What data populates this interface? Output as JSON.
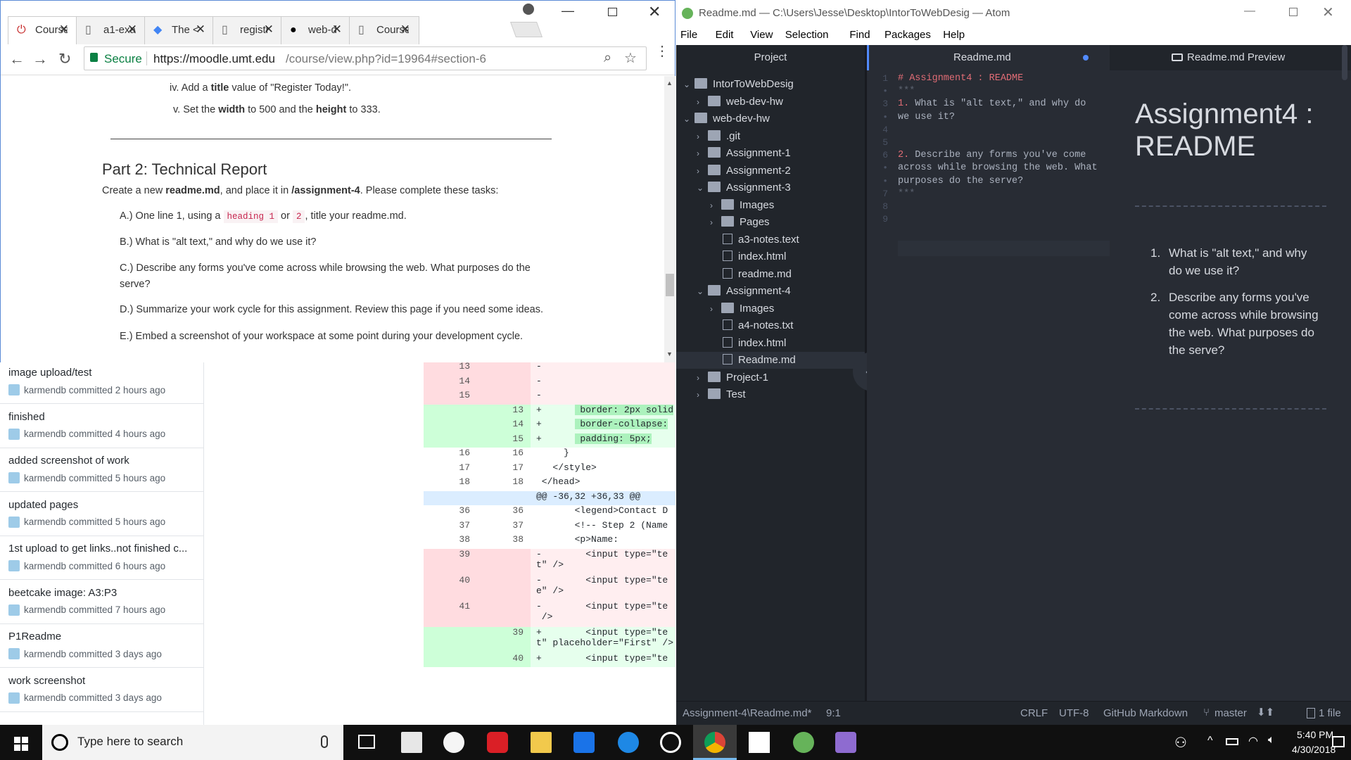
{
  "chrome": {
    "tabs": [
      {
        "title": "Course",
        "icon": "power-icon"
      },
      {
        "title": "a1-exa",
        "icon": "page-icon"
      },
      {
        "title": "The <",
        "icon": "drive-icon"
      },
      {
        "title": "registr",
        "icon": "page-icon"
      },
      {
        "title": "web-d",
        "icon": "github-icon"
      },
      {
        "title": "Course",
        "icon": "page-icon"
      }
    ],
    "secure_label": "Secure",
    "url_host": "https://moodle.umt.edu",
    "url_path": "/course/view.php?id=19964#section-6"
  },
  "moodle": {
    "line_iv_a": "iv. Add a ",
    "line_iv_b": "title",
    "line_iv_c": " value of \"Register Today!\".",
    "line_v_a": "v. Set the ",
    "line_v_b": "width",
    "line_v_c": " to 500 and the ",
    "line_v_d": "height",
    "line_v_e": " to 333.",
    "part2_title": "Part 2: Technical Report",
    "intro_a": "Create a new ",
    "intro_b": "readme.md",
    "intro_c": ", and place it in ",
    "intro_d": "/assignment-4",
    "intro_e": ". Please complete these tasks:",
    "task_a1": "A.) One line 1, using a ",
    "task_a_code1": "heading 1",
    "task_a_or": " or ",
    "task_a_code2": "2",
    "task_a2": ", title your readme.md.",
    "task_b": "B.) What is \"alt text,\" and why do we use it?",
    "task_c1": "C.) Describe any forms you've come across while browsing the web. What purposes do the",
    "task_c2": "serve?",
    "task_d1": "D.) Summarize your work cycle for this assignment. Review ",
    "task_d_link": "this page",
    "task_d2": " if you need some ideas.",
    "task_e": "E.) Embed a screenshot of your workspace at some point during your development cycle."
  },
  "commits": [
    {
      "message": "image upload/test",
      "meta": "karmendb committed 2 hours ago"
    },
    {
      "message": "finished",
      "meta": "karmendb committed 4 hours ago"
    },
    {
      "message": "added screenshot of work",
      "meta": "karmendb committed 5 hours ago"
    },
    {
      "message": "updated pages",
      "meta": "karmendb committed 5 hours ago"
    },
    {
      "message": "1st upload to get links..not finished c...",
      "meta": "karmendb committed 6 hours ago"
    },
    {
      "message": "beetcake image: A3:P3",
      "meta": "karmendb committed 7 hours ago"
    },
    {
      "message": "P1Readme",
      "meta": "karmendb committed 3 days ago"
    },
    {
      "message": "work screenshot",
      "meta": "karmendb committed 3 days ago"
    }
  ],
  "diff": [
    {
      "t": "del",
      "o": "13",
      "n": "",
      "c": "-"
    },
    {
      "t": "del",
      "o": "14",
      "n": "",
      "c": "-"
    },
    {
      "t": "del",
      "o": "15",
      "n": "",
      "c": "-"
    },
    {
      "t": "add",
      "o": "",
      "n": "13",
      "c": "+       border: 2px solid"
    },
    {
      "t": "add",
      "o": "",
      "n": "14",
      "c": "+       border-collapse:"
    },
    {
      "t": "add",
      "o": "",
      "n": "15",
      "c": "+       padding: 5px;"
    },
    {
      "t": "ctx",
      "o": "16",
      "n": "16",
      "c": "     }"
    },
    {
      "t": "ctx",
      "o": "17",
      "n": "17",
      "c": "   </style>"
    },
    {
      "t": "ctx",
      "o": "18",
      "n": "18",
      "c": " </head>"
    },
    {
      "t": "hunk",
      "o": "",
      "n": "",
      "c": "@@ -36,32 +36,33 @@"
    },
    {
      "t": "ctx",
      "o": "36",
      "n": "36",
      "c": "       <legend>Contact D"
    },
    {
      "t": "ctx",
      "o": "37",
      "n": "37",
      "c": "       <!-- Step 2 (Name"
    },
    {
      "t": "ctx",
      "o": "38",
      "n": "38",
      "c": "       <p>Name:"
    },
    {
      "t": "del2",
      "o": "39",
      "n": "",
      "c": "-        <input type=\"te",
      "c2": "t\" />"
    },
    {
      "t": "del2",
      "o": "40",
      "n": "",
      "c": "-        <input type=\"te",
      "c2": "e\" />"
    },
    {
      "t": "del2",
      "o": "41",
      "n": "",
      "c": "-        <input type=\"te",
      "c2": " />"
    },
    {
      "t": "add2",
      "o": "",
      "n": "39",
      "c": "+        <input type=\"te",
      "c2": "t\" placeholder=\"First\" />"
    },
    {
      "t": "add",
      "o": "",
      "n": "40",
      "c": "+        <input type=\"te"
    }
  ],
  "atom": {
    "title": "Readme.md — C:\\Users\\Jesse\\Desktop\\IntorToWebDesig — Atom",
    "menu": [
      "File",
      "Edit",
      "View",
      "Selection",
      "Find",
      "Packages",
      "Help"
    ],
    "project_tab": "Project",
    "editor_tab": "Readme.md",
    "preview_tab": "Readme.md Preview",
    "tree": [
      {
        "label": "IntorToWebDesig",
        "type": "folder",
        "open": true,
        "depth": 0
      },
      {
        "label": "web-dev-hw",
        "type": "folder",
        "open": false,
        "depth": 1
      },
      {
        "label": "web-dev-hw",
        "type": "folder",
        "open": true,
        "depth": 0
      },
      {
        "label": ".git",
        "type": "folder",
        "open": false,
        "depth": 1
      },
      {
        "label": "Assignment-1",
        "type": "folder",
        "open": false,
        "depth": 1
      },
      {
        "label": "Assignment-2",
        "type": "folder",
        "open": false,
        "depth": 1
      },
      {
        "label": "Assignment-3",
        "type": "folder",
        "open": true,
        "depth": 1
      },
      {
        "label": "Images",
        "type": "folder",
        "open": false,
        "depth": 2
      },
      {
        "label": "Pages",
        "type": "folder",
        "open": false,
        "depth": 2
      },
      {
        "label": "a3-notes.text",
        "type": "file",
        "depth": 2
      },
      {
        "label": "index.html",
        "type": "file",
        "depth": 2
      },
      {
        "label": "readme.md",
        "type": "md",
        "depth": 2
      },
      {
        "label": "Assignment-4",
        "type": "folder",
        "open": true,
        "depth": 1
      },
      {
        "label": "Images",
        "type": "folder",
        "open": false,
        "depth": 2
      },
      {
        "label": "a4-notes.txt",
        "type": "file",
        "depth": 2
      },
      {
        "label": "index.html",
        "type": "file",
        "depth": 2
      },
      {
        "label": "Readme.md",
        "type": "md",
        "depth": 2,
        "selected": true
      },
      {
        "label": "Project-1",
        "type": "folder",
        "open": false,
        "depth": 1
      },
      {
        "label": "Test",
        "type": "folder",
        "open": false,
        "depth": 1
      }
    ],
    "editor_lines": [
      {
        "n": "1",
        "text": "# Assignment4 : README",
        "color": "#e06c75"
      },
      {
        "n": "•",
        "text": "***",
        "color": "#5c6370"
      },
      {
        "n": "3",
        "text": "1. What is \"alt text,\" and why do",
        "color": "#abb2bf",
        "num": "1."
      },
      {
        "n": "•",
        "text": "we use it?",
        "color": "#abb2bf"
      },
      {
        "n": "4",
        "text": "",
        "color": "#abb2bf"
      },
      {
        "n": "5",
        "text": "",
        "color": "#abb2bf"
      },
      {
        "n": "6",
        "text": "2. Describe any forms you've come",
        "color": "#abb2bf",
        "num": "2."
      },
      {
        "n": "•",
        "text": "across while browsing the web. What",
        "color": "#abb2bf"
      },
      {
        "n": "•",
        "text": "purposes do the serve?",
        "color": "#abb2bf"
      },
      {
        "n": "7",
        "text": "***",
        "color": "#5c6370"
      },
      {
        "n": "8",
        "text": "",
        "color": "#abb2bf"
      },
      {
        "n": "9",
        "text": "",
        "color": "#abb2bf"
      }
    ],
    "preview_h1_line1": "Assignment4 :",
    "preview_h1_line2": "README",
    "preview_items": [
      {
        "num": "1.",
        "lines": [
          "What is \"alt text,\" and why",
          "do we use it?"
        ]
      },
      {
        "num": "2.",
        "lines": [
          "Describe any forms you've",
          "come across while browsing",
          "the web. What purposes do",
          "the serve?"
        ]
      }
    ],
    "status": {
      "path": "Assignment-4\\Readme.md*",
      "cursor": "9:1",
      "line_ending": "CRLF",
      "encoding": "UTF-8",
      "grammar": "GitHub Markdown",
      "branch": "master",
      "changes": "1 file"
    }
  },
  "taskbar": {
    "search_placeholder": "Type here to search",
    "time": "5:40 PM",
    "date": "4/30/2018"
  },
  "colors": {
    "atom_bg": "#21252b",
    "editor_bg": "#282c34",
    "accent": "#528bff",
    "heading_red": "#e06c75"
  }
}
